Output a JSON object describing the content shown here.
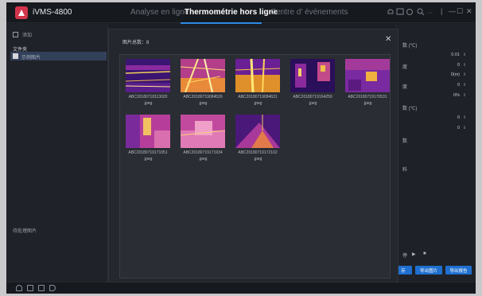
{
  "window": {
    "app_name": "iVMS-4800"
  },
  "tabs": [
    {
      "label": "Analyse en ligne",
      "active": false
    },
    {
      "label": "Thermométrie hors ligne",
      "active": true
    },
    {
      "label": "Centre d'   événements",
      "active": false
    }
  ],
  "window_controls": {
    "minimize": "—",
    "maximize": "☐",
    "close": "✕",
    "separator": "|"
  },
  "left_panel": {
    "add_label": "添加",
    "folder_heading": "文件夹",
    "folder_item": "示例图片",
    "pending_label": "待处理图片"
  },
  "dialog": {
    "title": "图片总数：8",
    "close_glyph": "✕",
    "images": [
      {
        "name": "ABC20180718113020",
        "ext": ".jpeg",
        "palette": "iron-lines"
      },
      {
        "name": "ABC20180719084526",
        "ext": ".jpeg",
        "palette": "iron-tower"
      },
      {
        "name": "ABC20180719084631",
        "ext": ".jpeg",
        "palette": "iron-bright"
      },
      {
        "name": "ABC20180719164259",
        "ext": ".jpeg",
        "palette": "iron-dark"
      },
      {
        "name": "ABC20180719170531",
        "ext": ".jpeg",
        "palette": "iron-room"
      },
      {
        "name": "ABC20180719171051",
        "ext": ".jpeg",
        "palette": "iron-wall"
      },
      {
        "name": "ABC20180719171934",
        "ext": ".jpeg",
        "palette": "iron-pink"
      },
      {
        "name": "ABC20180719172102",
        "ext": ".jpeg",
        "palette": "iron-corner"
      }
    ]
  },
  "right_panel": {
    "fields": [
      {
        "label": "数 (℃)",
        "value": ""
      },
      {
        "label": "",
        "value": "0.01"
      },
      {
        "label": "度",
        "value": "0"
      },
      {
        "label": "",
        "value": "0(m)"
      },
      {
        "label": "度",
        "value": "0"
      },
      {
        "label": "",
        "value": "0%"
      },
      {
        "label": "数 (℃)",
        "value": ""
      },
      {
        "label": "",
        "value": "0"
      },
      {
        "label": "",
        "value": "0"
      },
      {
        "label": "数",
        "value": ""
      }
    ],
    "section_label": "料",
    "spinner_glyph": "⇕",
    "playback": {
      "label": "停",
      "play": "▶",
      "stop": "■"
    },
    "buttons": [
      "存",
      "导出图片",
      "导出报告"
    ]
  },
  "bottom_bar": {
    "icons": [
      "bell-icon",
      "document-icon",
      "monitor-icon",
      "speaker-icon"
    ]
  },
  "colors": {
    "accent": "#2c8be6",
    "button": "#1f6fcf",
    "background": "#1b1e24"
  }
}
